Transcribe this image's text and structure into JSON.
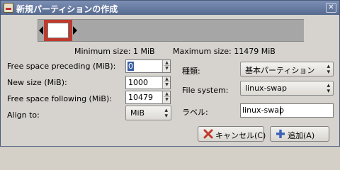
{
  "window": {
    "title": "新規パーティションの作成",
    "close_glyph": "✕"
  },
  "graph": {
    "min_label": "Minimum size: 1 MiB",
    "max_label": "Maximum size: 11479 MiB"
  },
  "left": {
    "preceding_label": "Free space preceding (MiB):",
    "preceding_value": "0",
    "new_size_label": "New size (MiB):",
    "new_size_value": "1000",
    "following_label": "Free space following (MiB):",
    "following_value": "10479",
    "align_label": "Align to:",
    "align_value": "MiB"
  },
  "right": {
    "type_label": "種類:",
    "type_value": "基本パーティション",
    "fs_label": "File system:",
    "fs_value": "linux-swap",
    "label_label": "ラベル:",
    "label_value": "linux-swap"
  },
  "buttons": {
    "cancel": "キャンセル(C)",
    "add": "追加(A)"
  },
  "colors": {
    "used": "#c0392b",
    "title_bar": "#56698f",
    "cancel_icon": "#c0392b",
    "add_icon": "#3b63b8"
  }
}
